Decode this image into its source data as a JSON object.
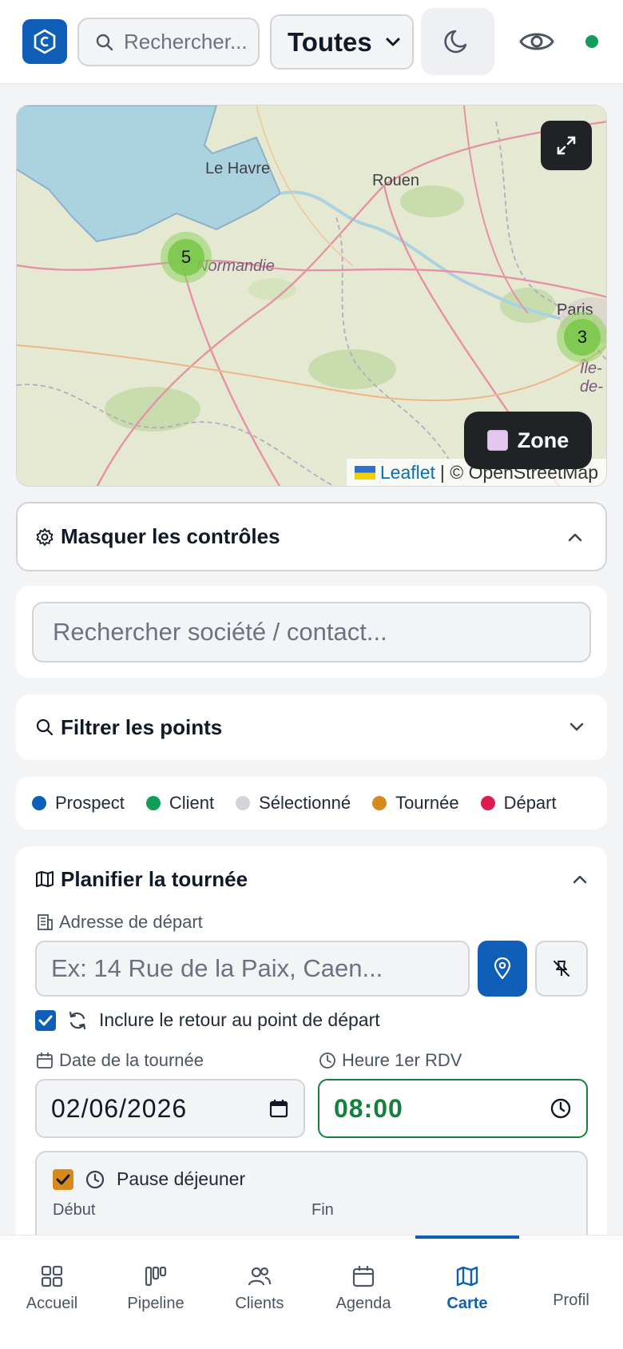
{
  "header": {
    "search_placeholder": "Rechercher...",
    "filter_select_value": "Toutes",
    "status_color": "#0f9d58"
  },
  "map": {
    "labels": [
      "Le Havre",
      "Rouen",
      "Normandie",
      "Paris",
      "Île-de-"
    ],
    "clusters": [
      {
        "count": "5",
        "color": "#8fd160"
      },
      {
        "count": "3",
        "color": "#8fd160"
      }
    ],
    "zone_button_label": "Zone",
    "attribution_link": "Leaflet",
    "attribution_text": "| © OpenStreetMap"
  },
  "controls": {
    "toggle_label": "Masquer les contrôles"
  },
  "company_search": {
    "placeholder": "Rechercher société / contact..."
  },
  "filter": {
    "title": "Filtrer les points"
  },
  "legend": {
    "items": [
      {
        "label": "Prospect",
        "color": "#0f5fb8"
      },
      {
        "label": "Client",
        "color": "#0f9d58"
      },
      {
        "label": "Sélectionné",
        "color": "#d1d5db"
      },
      {
        "label": "Tournée",
        "color": "#d68a1e"
      },
      {
        "label": "Départ",
        "color": "#dc1e4c"
      }
    ]
  },
  "tour": {
    "title": "Planifier la tournée",
    "start_address_label": "Adresse de départ",
    "start_address_placeholder": "Ex: 14 Rue de la Paix, Caen...",
    "return_label": "Inclure le retour au point de départ",
    "return_checked": true,
    "date_label": "Date de la tournée",
    "date_value": "02/06/2026",
    "time_label": "Heure 1er RDV",
    "time_value": "08:00",
    "pause_label": "Pause déjeuner",
    "pause_checked": true,
    "pause_start_label": "Début",
    "pause_end_label": "Fin"
  },
  "bottom_nav": {
    "items": [
      {
        "label": "Accueil",
        "icon": "grid-icon"
      },
      {
        "label": "Pipeline",
        "icon": "kanban-icon"
      },
      {
        "label": "Clients",
        "icon": "users-icon"
      },
      {
        "label": "Agenda",
        "icon": "calendar-icon"
      },
      {
        "label": "Carte",
        "icon": "map-icon",
        "active": true
      },
      {
        "label": "Profil",
        "icon": ""
      }
    ],
    "accent": "#0f5fb8"
  }
}
